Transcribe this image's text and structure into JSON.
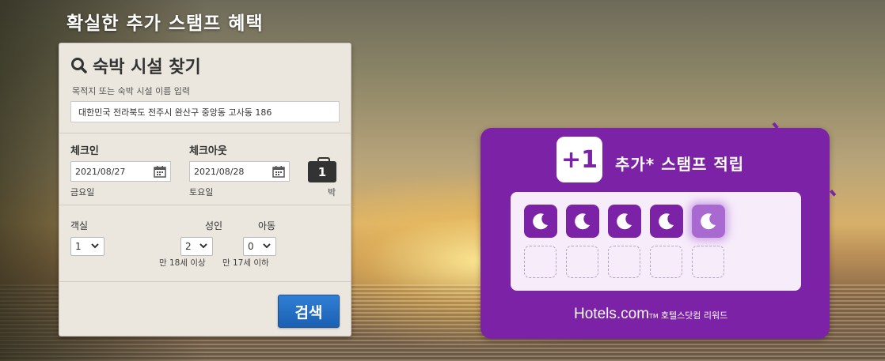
{
  "banner": {
    "title": "확실한 추가 스탬프 혜택"
  },
  "search": {
    "title": "숙박 시설 찾기",
    "destination_label": "목적지 또는 숙박 시설 이름 입력",
    "destination_value": "대한민국 전라북도 전주시 완산구 중앙동 고사동 186",
    "checkin_label": "체크인",
    "checkin_value": "2021/08/27",
    "checkin_day": "금요일",
    "checkout_label": "체크아웃",
    "checkout_value": "2021/08/28",
    "checkout_day": "토요일",
    "nights_value": "1",
    "nights_label": "박",
    "rooms_label": "객실",
    "rooms_value": "1",
    "adults_label": "성인",
    "adults_value": "2",
    "adults_note": "만 18세 이상",
    "children_label": "아동",
    "children_value": "0",
    "children_note": "만 17세 이하",
    "search_button": "검색"
  },
  "promo": {
    "badge": "+1",
    "headline": "추가* 스탬프 적립",
    "stamps_filled": 5,
    "stamps_total": 10,
    "brand": "Hotels.com",
    "brand_tm": "TM",
    "brand_suffix": "호텔스닷컴 리워드"
  },
  "colors": {
    "purple": "#7b22a6",
    "blue_button": "#1b60b3"
  }
}
